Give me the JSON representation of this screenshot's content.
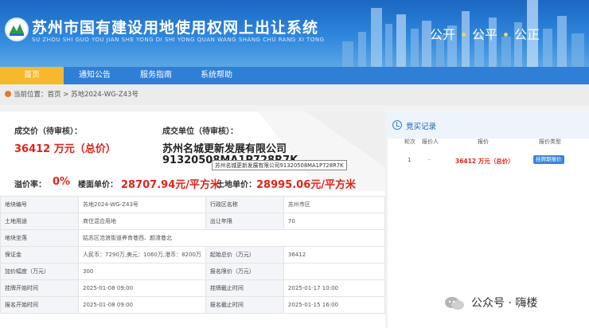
{
  "header": {
    "title": "苏州市国有建设用地使用权网上出让系统",
    "subtitle": "SU ZHOU SHI GUO YOU JIAN SHE YONG DI SHI YONG QUAN WANG SHANG CHU RANG XI TONG",
    "slogan": [
      "公开",
      "公平",
      "公正"
    ]
  },
  "nav": {
    "items": [
      {
        "label": "首页",
        "active": true
      },
      {
        "label": "通知公告",
        "active": false
      },
      {
        "label": "服务指南",
        "active": false
      },
      {
        "label": "系统帮助",
        "active": false
      }
    ]
  },
  "breadcrumb": {
    "prefix": "当前位置：",
    "home": "首页",
    "sep": ">",
    "current": "苏地2024-WG-Z43号"
  },
  "deal": {
    "price_label": "成交价（待审核）：",
    "price_value": "36412 万元（总价）",
    "buyer_label": "成交单位（待审核）：",
    "buyer_name": "苏州名城更新发展有限公司",
    "buyer_code": "91320508MA1P728R7K",
    "tooltip": "苏州名城更新发展有限公司91320508MA1P728R7K",
    "premium_label": "溢价率：",
    "premium_value": "0%",
    "floor_price_label": "楼面单价：",
    "floor_price_value": "28707.94元/平方米",
    "land_price_label": "土地单价：",
    "land_price_value": "28995.06元/平方米"
  },
  "info_rows": [
    [
      "地块编号",
      "苏地2024-WG-Z43号",
      "行政区名称",
      "苏州市区"
    ],
    [
      "土地用途",
      "商住混合用地",
      "出让年限",
      "70"
    ],
    [
      "地块坐落",
      "姑苏区沧浪街道养育巷西、颜渣巷北",
      "",
      ""
    ],
    [
      "保证金",
      "人民币：7290万,美元：1060万,港币：8200万",
      "起始总价（万元）",
      "36412"
    ],
    [
      "加价幅度（万元）",
      "300",
      "报名限价（万元）",
      ""
    ],
    [
      "挂牌开始时间",
      "2025-01-08 09:00",
      "挂牌截止时间",
      "2025-01-17 10:00"
    ],
    [
      "报名开始时间",
      "2025-01-08 09:00",
      "报名截止时间",
      "2025-01-15 16:00"
    ]
  ],
  "bid_record": {
    "title": "竞买记录",
    "columns": [
      "轮次",
      "报价人",
      "报价",
      "报价类型"
    ],
    "rows": [
      {
        "round": "1",
        "bidder": "-",
        "price": "36412 万元（总价）",
        "type": "挂牌期报价"
      }
    ]
  },
  "watermark": {
    "text": "公众号 · 嗨楼"
  },
  "colors": {
    "header_blue": "#2f7fd7",
    "nav_active": "#f6b92b",
    "price_red": "#e2231a"
  }
}
